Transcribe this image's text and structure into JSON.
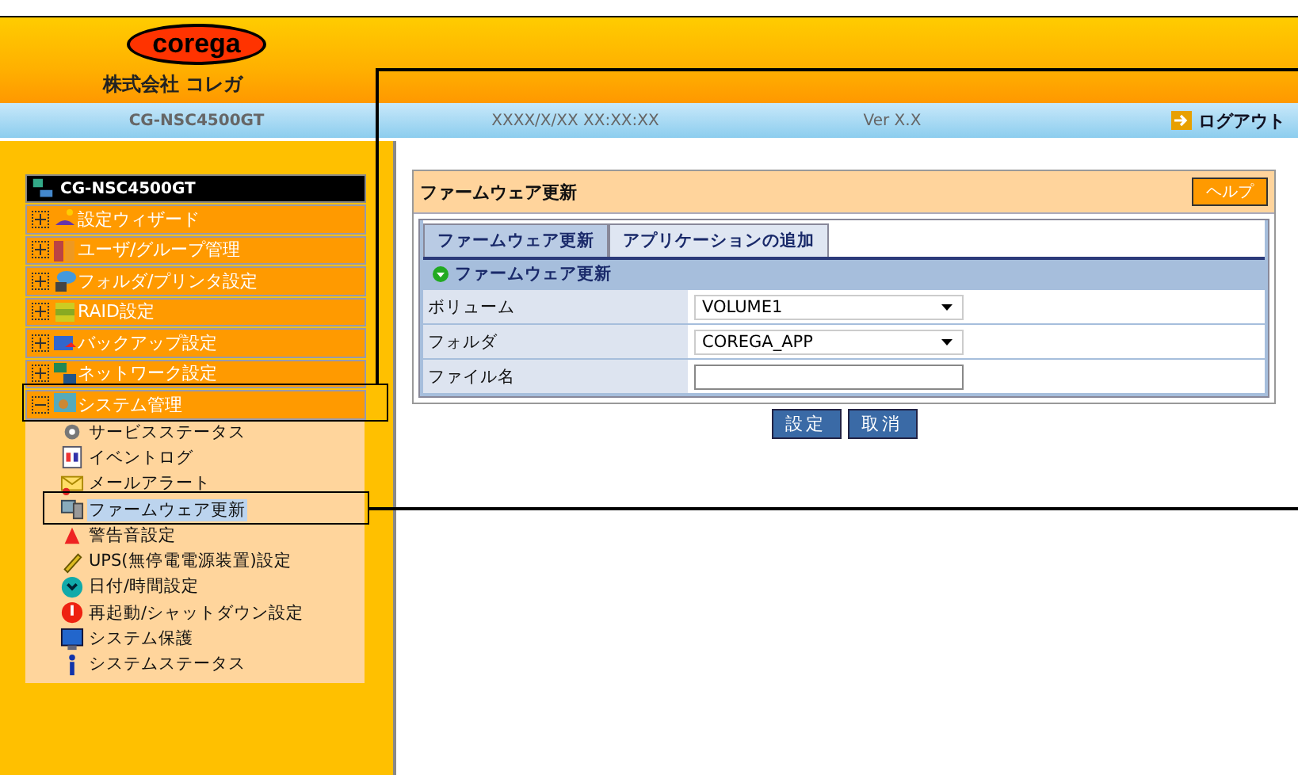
{
  "header": {
    "logo": "corega",
    "company": "株式会社 コレガ"
  },
  "info_bar": {
    "model": "CG-NSC4500GT",
    "datetime": "XXXX/X/XX XX:XX:XX",
    "version": "Ver X.X",
    "logout": "ログアウト"
  },
  "sidebar": {
    "root": "CG-NSC4500GT",
    "items": [
      {
        "label": "設定ウィザード",
        "expanded": false
      },
      {
        "label": "ユーザ/グループ管理",
        "expanded": false
      },
      {
        "label": "フォルダ/プリンタ設定",
        "expanded": false
      },
      {
        "label": "RAID設定",
        "expanded": false
      },
      {
        "label": "バックアップ設定",
        "expanded": false
      },
      {
        "label": "ネットワーク設定",
        "expanded": false
      },
      {
        "label": "システム管理",
        "expanded": true,
        "children": [
          {
            "label": "サービスステータス",
            "selected": false
          },
          {
            "label": "イベントログ",
            "selected": false
          },
          {
            "label": "メールアラート",
            "selected": false
          },
          {
            "label": "ファームウェア更新",
            "selected": true
          },
          {
            "label": "警告音設定",
            "selected": false
          },
          {
            "label": "UPS(無停電電源装置)設定",
            "selected": false
          },
          {
            "label": "日付/時間設定",
            "selected": false
          },
          {
            "label": "再起動/シャットダウン設定",
            "selected": false
          },
          {
            "label": "システム保護",
            "selected": false
          },
          {
            "label": "システムステータス",
            "selected": false
          }
        ]
      }
    ]
  },
  "panel": {
    "title": "ファームウェア更新",
    "help": "ヘルプ",
    "tabs": [
      {
        "label": "ファームウェア更新",
        "selected": true
      },
      {
        "label": "アプリケーションの追加",
        "selected": false
      }
    ],
    "section": "ファームウェア更新",
    "fields": [
      {
        "label": "ボリューム",
        "kind": "select",
        "value": "VOLUME1"
      },
      {
        "label": "フォルダ",
        "kind": "select",
        "value": "COREGA_APP"
      },
      {
        "label": "ファイル名",
        "kind": "text"
      }
    ],
    "buttons": [
      "設定",
      "取消"
    ]
  }
}
